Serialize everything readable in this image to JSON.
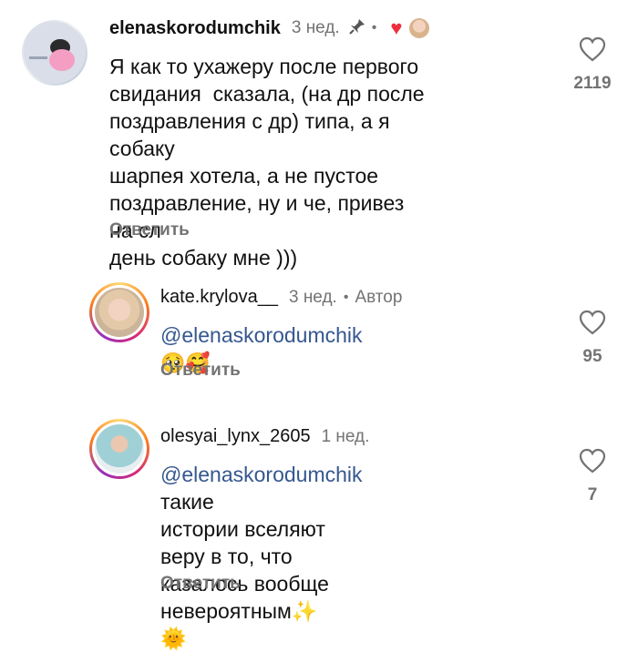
{
  "comments": [
    {
      "username": "elenaskorodumchik",
      "time": "3 нед.",
      "text_lines": [
        "Я как то ухажеру после первого",
        "свидания  сказала, (на др после",
        "поздравления с др) типа, а я собаку",
        "шарпея хотела, а не пустое",
        "поздравление, ну и че, привез на сл",
        "день собаку мне )))"
      ],
      "reply_label": "Ответить",
      "like_count": "2119",
      "icons": [
        "pin-icon",
        "liked-by-author-heart-icon",
        "author-avatar-mini"
      ]
    },
    {
      "username": "kate.krylova__",
      "time": "3 нед.",
      "author_label": "Автор",
      "mention": "@elenaskorodumchik",
      "text_after": "🥺🥰",
      "reply_label": "Ответить",
      "like_count": "95"
    },
    {
      "username": "olesyai_lynx_2605",
      "time": "1 нед.",
      "mention": "@elenaskorodumchik",
      "text_line1_rest": " такие",
      "text_lines": [
        "истории вселяют веру в то, что",
        "казалось вообще невероятным✨",
        "🌞"
      ],
      "reply_label": "Ответить",
      "like_count": "7"
    }
  ],
  "colors": {
    "muted": "#737373",
    "mention": "#35578f",
    "heart": "#ed2d3b"
  }
}
